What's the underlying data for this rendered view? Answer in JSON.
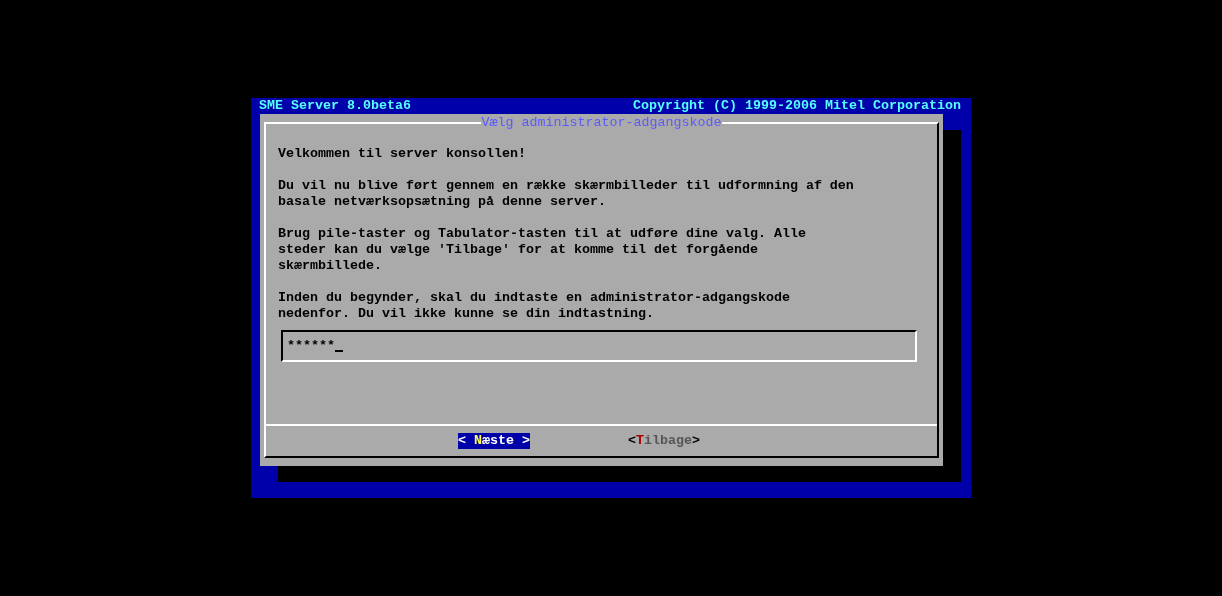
{
  "header": {
    "title": "SME Server 8.0beta6",
    "copyright": "Copyright (C) 1999-2006 Mitel Corporation"
  },
  "dialog": {
    "title": "Vælg administrator-adgangskode",
    "paragraphs": [
      {
        "lines": [
          "Velkommen til server konsollen!"
        ]
      },
      {
        "lines": [
          "Du vil nu blive ført gennem en række skærmbilleder til udformning af den",
          "basale netværksopsætning på denne server."
        ]
      },
      {
        "lines": [
          "Brug pile-taster og Tabulator-tasten til at udføre dine valg. Alle",
          "steder kan du vælge 'Tilbage' for at komme til det forgående",
          "skærmbillede."
        ]
      },
      {
        "lines": [
          "Inden du begynder, skal du indtaste en administrator-adgangskode",
          "nedenfor. Du vil ikke kunne se din indtastning."
        ]
      }
    ],
    "password": {
      "value": "******"
    },
    "buttons": [
      {
        "open": "< ",
        "hotkey": "N",
        "rest": "æste",
        "close": " >",
        "selected": true
      },
      {
        "open": "<",
        "hotkey": "T",
        "rest": "ilbage",
        "close": ">",
        "selected": false
      }
    ]
  }
}
